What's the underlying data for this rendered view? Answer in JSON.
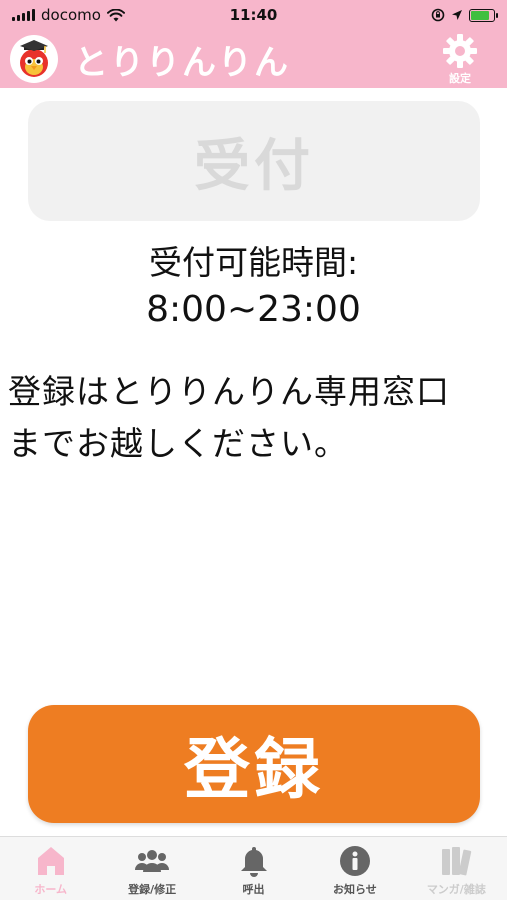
{
  "status_bar": {
    "carrier": "docomo",
    "time": "11:40"
  },
  "header": {
    "app_title": "とりりんりん",
    "settings_label": "設定"
  },
  "reception_button": {
    "label": "受付"
  },
  "hours": {
    "label": "受付可能時間:",
    "value": "8:00~23:00"
  },
  "notice": {
    "text": "登録はとりりんりん専用窓口までお越しください。"
  },
  "register_button": {
    "label": "登録"
  },
  "tabs": [
    {
      "label": "ホーム",
      "icon": "home-icon",
      "state": "active"
    },
    {
      "label": "登録/修正",
      "icon": "users-icon",
      "state": "normal"
    },
    {
      "label": "呼出",
      "icon": "bell-icon",
      "state": "normal"
    },
    {
      "label": "お知らせ",
      "icon": "info-icon",
      "state": "normal"
    },
    {
      "label": "マンガ/雑誌",
      "icon": "books-icon",
      "state": "disabled"
    }
  ],
  "colors": {
    "header_pink": "#f7b6cb",
    "register_orange": "#ee7d22",
    "reception_disabled_bg": "#f1f1f1",
    "reception_disabled_text": "#d9d9d9",
    "tab_active": "#f7b6cb",
    "battery_green": "#3fbf3f"
  }
}
